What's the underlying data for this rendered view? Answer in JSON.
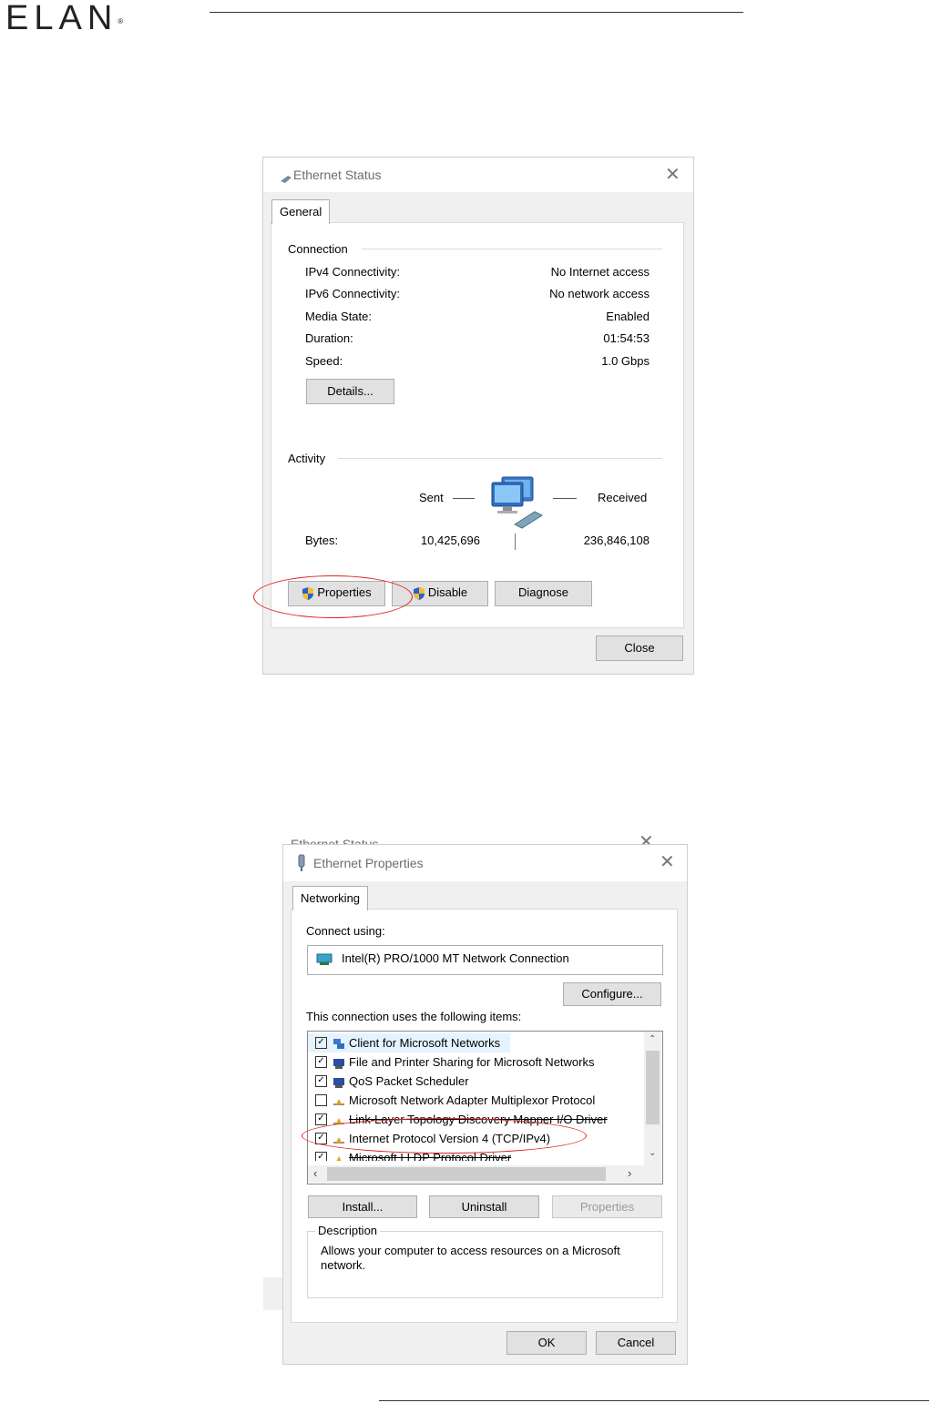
{
  "doc": {
    "logo_text": "ELAN",
    "logo_reg": "®"
  },
  "status_dialog": {
    "title": "Ethernet Status",
    "close_glyph": "✕",
    "tab": "General",
    "connection_label": "Connection",
    "rows": [
      {
        "label": "IPv4 Connectivity:",
        "value": "No Internet access"
      },
      {
        "label": "IPv6 Connectivity:",
        "value": "No network access"
      },
      {
        "label": "Media State:",
        "value": "Enabled"
      },
      {
        "label": "Duration:",
        "value": "01:54:53"
      },
      {
        "label": "Speed:",
        "value": "1.0 Gbps"
      }
    ],
    "details_button": "Details...",
    "activity_label": "Activity",
    "sent_label": "Sent",
    "received_label": "Received",
    "bytes_label": "Bytes:",
    "bytes_sent": "10,425,696",
    "bytes_received": "236,846,108",
    "properties_button": "Properties",
    "disable_button": "Disable",
    "diagnose_button": "Diagnose",
    "close_button": "Close"
  },
  "props_dialog": {
    "behind_title": "Ethernet Status",
    "title": "Ethernet Properties",
    "close_glyph": "✕",
    "tab": "Networking",
    "connect_using_label": "Connect using:",
    "adapter": "Intel(R) PRO/1000 MT Network Connection",
    "configure_button": "Configure...",
    "items_label": "This connection uses the following items:",
    "items": [
      {
        "label": "Client for Microsoft Networks",
        "checked": true,
        "icon": "network-client-icon"
      },
      {
        "label": "File and Printer Sharing for Microsoft Networks",
        "checked": true,
        "icon": "network-service-icon"
      },
      {
        "label": "QoS Packet Scheduler",
        "checked": true,
        "icon": "network-service-icon"
      },
      {
        "label": "Microsoft Network Adapter Multiplexor Protocol",
        "checked": false,
        "icon": "protocol-icon"
      },
      {
        "label": "Link-Layer Topology Discovery Mapper I/O Driver",
        "checked": true,
        "icon": "protocol-icon"
      },
      {
        "label": "Internet Protocol Version 4 (TCP/IPv4)",
        "checked": true,
        "icon": "protocol-icon"
      },
      {
        "label": "Microsoft LLDP Protocol Driver",
        "checked": true,
        "icon": "protocol-icon"
      }
    ],
    "install_button": "Install...",
    "uninstall_button": "Uninstall",
    "properties_button": "Properties",
    "description_label": "Description",
    "description_text": "Allows your computer to access resources on a Microsoft network.",
    "ok_button": "OK",
    "cancel_button": "Cancel"
  },
  "colors": {
    "annotation": "#dd2222",
    "button_face": "#e1e1e1",
    "selection": "#e5f3ff"
  }
}
